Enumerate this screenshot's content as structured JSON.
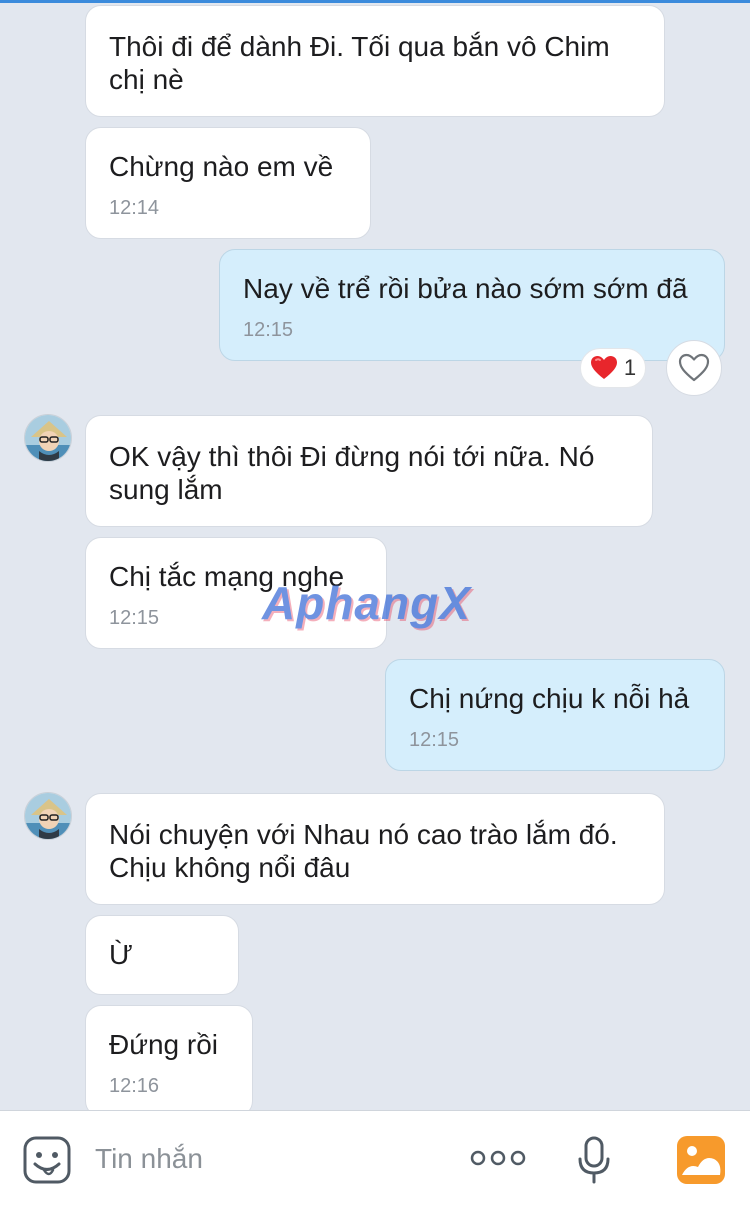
{
  "colors": {
    "background": "#e2e7ef",
    "incoming_bubble": "#ffffff",
    "outgoing_bubble": "#d5eefc",
    "image_button": "#f79a2c"
  },
  "messages": [
    {
      "side": "incoming",
      "text": "Thôi đi để dành Đi.  Tối qua bắn vô Chim chị nè",
      "time": ""
    },
    {
      "side": "incoming",
      "text": "Chừng nào em về",
      "time": "12:14"
    },
    {
      "side": "outgoing",
      "text": "Nay về trể rồi bửa nào sớm sớm đã",
      "time": "12:15"
    },
    {
      "side": "incoming",
      "text": "OK vậy thì thôi Đi đừng nói tới nữa.  Nó sung lắm",
      "time": ""
    },
    {
      "side": "incoming",
      "text": "Chị tắc mạng nghe",
      "time": "12:15"
    },
    {
      "side": "outgoing",
      "text": "Chị nứng chịu k nỗi hả",
      "time": "12:15"
    },
    {
      "side": "incoming",
      "text": "Nói chuyện với Nhau nó cao trào lắm đó.\nChịu không nổi đâu",
      "time": ""
    },
    {
      "side": "incoming",
      "text": "Ừ",
      "time": ""
    },
    {
      "side": "incoming",
      "text": "Đứng rồi",
      "time": "12:16"
    }
  ],
  "reaction": {
    "icon": "heart-icon",
    "count": "1"
  },
  "watermark": "AphangX",
  "input_bar": {
    "placeholder": "Tin nhắn",
    "icons": [
      "emoji-icon",
      "more-icon",
      "microphone-icon",
      "image-icon"
    ]
  }
}
